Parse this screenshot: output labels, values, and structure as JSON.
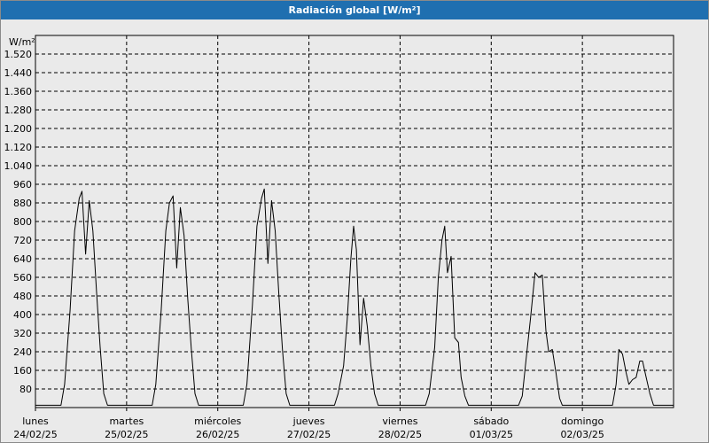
{
  "window": {
    "title": "Radiación global [W/m²]"
  },
  "chart_data": {
    "type": "line",
    "title": "Radiación global [W/m²]",
    "ylabel": "W/m²",
    "ylim": [
      0,
      1600
    ],
    "yticks": [
      80,
      160,
      240,
      320,
      400,
      480,
      560,
      640,
      720,
      800,
      880,
      960,
      1040,
      1120,
      1200,
      1280,
      1360,
      1440,
      1520
    ],
    "ytick_labels": [
      "80",
      "160",
      "240",
      "320",
      "400",
      "480",
      "560",
      "640",
      "720",
      "800",
      "880",
      "960",
      "1.040",
      "1.120",
      "1.200",
      "1.280",
      "1.360",
      "1.440",
      "1.520"
    ],
    "xlim": [
      0,
      7
    ],
    "x_unit": "days since 24/02/25 00:00",
    "days": [
      {
        "name": "lunes",
        "date": "24/02/25"
      },
      {
        "name": "martes",
        "date": "25/02/25"
      },
      {
        "name": "miércoles",
        "date": "26/02/25"
      },
      {
        "name": "jueves",
        "date": "27/02/25"
      },
      {
        "name": "viernes",
        "date": "28/02/25"
      },
      {
        "name": "sábado",
        "date": "01/03/25"
      },
      {
        "name": "domingo",
        "date": "02/03/25"
      }
    ],
    "grid": true,
    "line_color": "#000000",
    "series": [
      {
        "name": "Radiación global",
        "points": [
          [
            0.0,
            10
          ],
          [
            0.05,
            10
          ],
          [
            0.28,
            10
          ],
          [
            0.32,
            100
          ],
          [
            0.38,
            420
          ],
          [
            0.43,
            760
          ],
          [
            0.48,
            900
          ],
          [
            0.51,
            930
          ],
          [
            0.55,
            660
          ],
          [
            0.59,
            890
          ],
          [
            0.63,
            760
          ],
          [
            0.67,
            500
          ],
          [
            0.71,
            260
          ],
          [
            0.75,
            60
          ],
          [
            0.79,
            10
          ],
          [
            1.0,
            10
          ],
          [
            1.28,
            10
          ],
          [
            1.32,
            100
          ],
          [
            1.38,
            420
          ],
          [
            1.43,
            760
          ],
          [
            1.47,
            880
          ],
          [
            1.51,
            910
          ],
          [
            1.55,
            600
          ],
          [
            1.59,
            860
          ],
          [
            1.63,
            740
          ],
          [
            1.67,
            470
          ],
          [
            1.71,
            250
          ],
          [
            1.75,
            60
          ],
          [
            1.79,
            10
          ],
          [
            2.0,
            10
          ],
          [
            2.28,
            10
          ],
          [
            2.32,
            100
          ],
          [
            2.38,
            440
          ],
          [
            2.43,
            780
          ],
          [
            2.48,
            900
          ],
          [
            2.51,
            940
          ],
          [
            2.55,
            620
          ],
          [
            2.59,
            890
          ],
          [
            2.63,
            760
          ],
          [
            2.67,
            490
          ],
          [
            2.71,
            250
          ],
          [
            2.75,
            60
          ],
          [
            2.79,
            10
          ],
          [
            3.0,
            10
          ],
          [
            3.28,
            10
          ],
          [
            3.32,
            60
          ],
          [
            3.38,
            180
          ],
          [
            3.42,
            380
          ],
          [
            3.46,
            640
          ],
          [
            3.49,
            780
          ],
          [
            3.52,
            680
          ],
          [
            3.56,
            270
          ],
          [
            3.6,
            470
          ],
          [
            3.64,
            350
          ],
          [
            3.68,
            180
          ],
          [
            3.72,
            60
          ],
          [
            3.76,
            10
          ],
          [
            4.0,
            10
          ],
          [
            4.28,
            10
          ],
          [
            4.32,
            60
          ],
          [
            4.38,
            260
          ],
          [
            4.42,
            560
          ],
          [
            4.46,
            720
          ],
          [
            4.49,
            780
          ],
          [
            4.52,
            580
          ],
          [
            4.56,
            650
          ],
          [
            4.6,
            300
          ],
          [
            4.64,
            280
          ],
          [
            4.67,
            130
          ],
          [
            4.71,
            50
          ],
          [
            4.75,
            10
          ],
          [
            5.0,
            10
          ],
          [
            5.3,
            10
          ],
          [
            5.34,
            50
          ],
          [
            5.38,
            200
          ],
          [
            5.43,
            380
          ],
          [
            5.48,
            580
          ],
          [
            5.52,
            560
          ],
          [
            5.56,
            570
          ],
          [
            5.6,
            330
          ],
          [
            5.63,
            240
          ],
          [
            5.67,
            250
          ],
          [
            5.71,
            150
          ],
          [
            5.75,
            40
          ],
          [
            5.78,
            10
          ],
          [
            6.0,
            10
          ],
          [
            6.33,
            10
          ],
          [
            6.37,
            100
          ],
          [
            6.4,
            250
          ],
          [
            6.44,
            230
          ],
          [
            6.48,
            150
          ],
          [
            6.51,
            100
          ],
          [
            6.55,
            120
          ],
          [
            6.59,
            130
          ],
          [
            6.63,
            200
          ],
          [
            6.66,
            200
          ],
          [
            6.7,
            130
          ],
          [
            6.74,
            60
          ],
          [
            6.78,
            10
          ],
          [
            7.0,
            10
          ]
        ]
      }
    ]
  }
}
